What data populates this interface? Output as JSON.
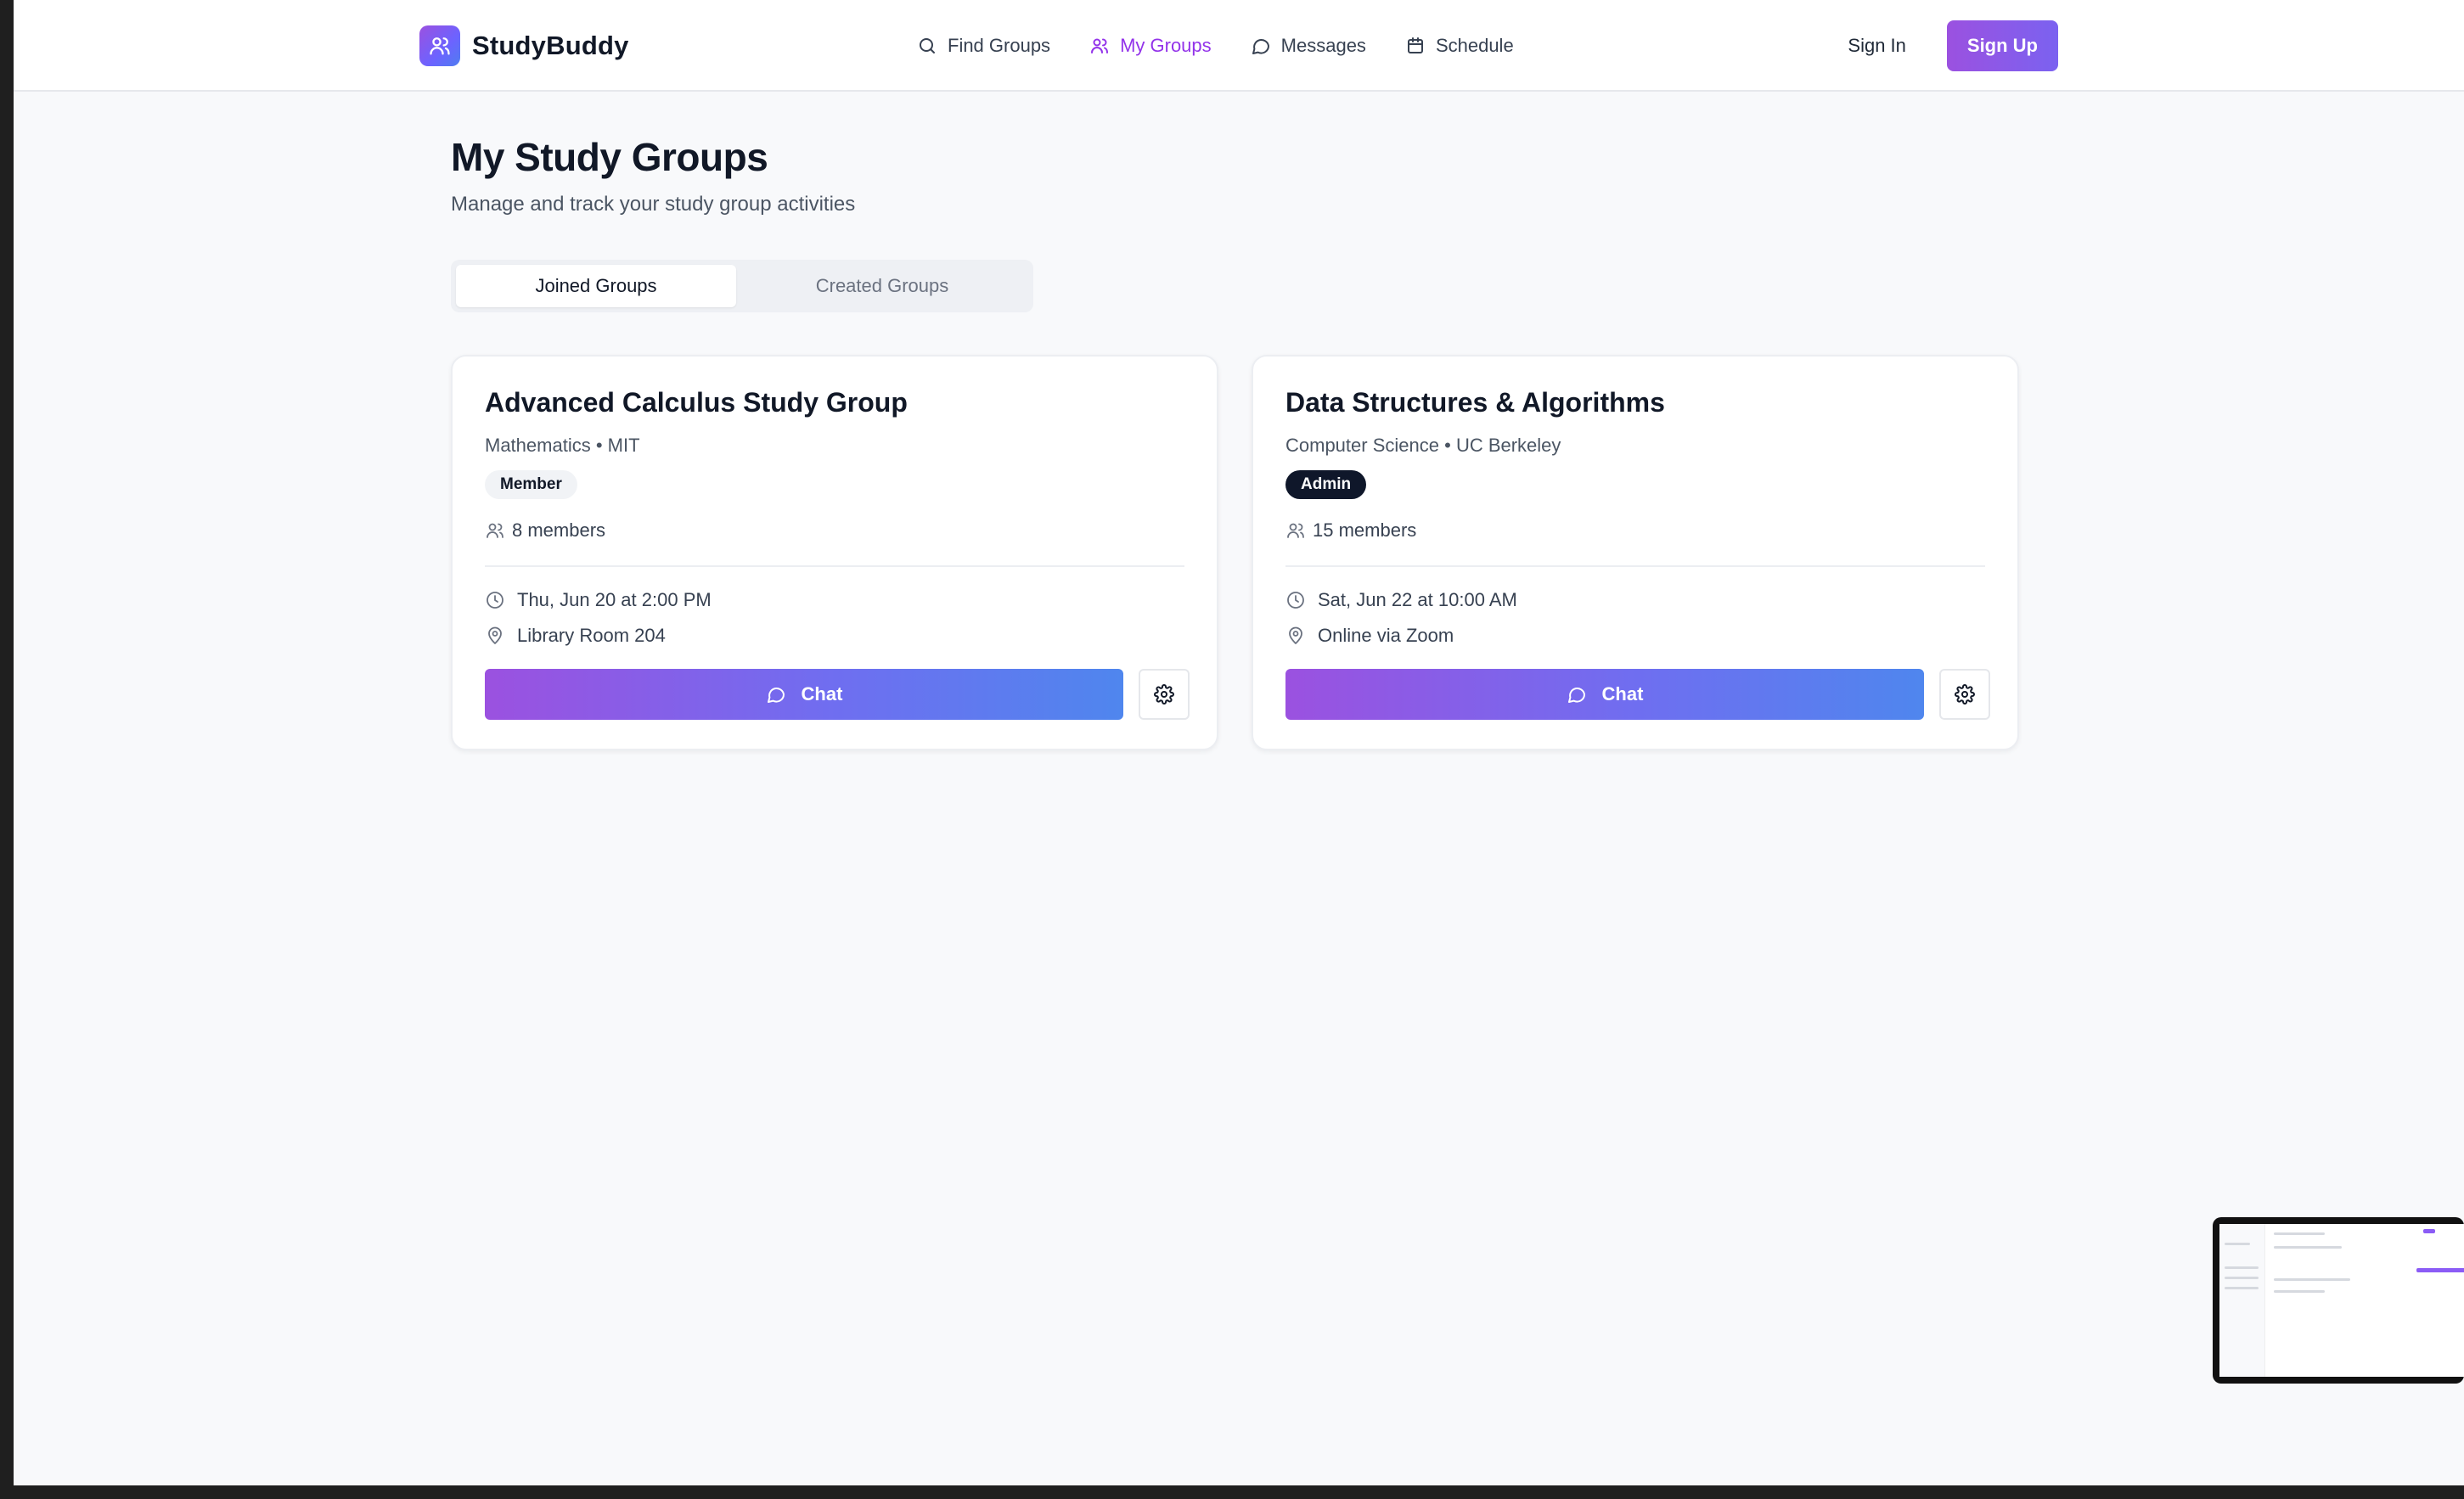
{
  "brand": {
    "name": "StudyBuddy",
    "logo_icon": "users-icon"
  },
  "nav": [
    {
      "label": "Find Groups",
      "icon": "search-icon",
      "active": false
    },
    {
      "label": "My Groups",
      "icon": "users-icon",
      "active": true
    },
    {
      "label": "Messages",
      "icon": "message-icon",
      "active": false
    },
    {
      "label": "Schedule",
      "icon": "calendar-icon",
      "active": false
    }
  ],
  "auth": {
    "signin": "Sign In",
    "signup": "Sign Up"
  },
  "page": {
    "title": "My Study Groups",
    "subtitle": "Manage and track your study group activities"
  },
  "tabs": [
    {
      "label": "Joined Groups",
      "active": true
    },
    {
      "label": "Created Groups",
      "active": false
    }
  ],
  "groups": [
    {
      "title": "Advanced Calculus Study Group",
      "subject": "Mathematics",
      "separator": "•",
      "school": "MIT",
      "role": "Member",
      "members": "8 members",
      "when": "Thu, Jun 20 at 2:00 PM",
      "where": "Library Room 204",
      "chat_label": "Chat"
    },
    {
      "title": "Data Structures & Algorithms",
      "subject": "Computer Science",
      "separator": "•",
      "school": "UC Berkeley",
      "role": "Admin",
      "members": "15 members",
      "when": "Sat, Jun 22 at 10:00 AM",
      "where": "Online via Zoom",
      "chat_label": "Chat"
    }
  ],
  "colors": {
    "accent": "#9333ea",
    "gradient_start": "#9b51e0",
    "gradient_end": "#4f86ee",
    "admin_badge": "#0f172a"
  }
}
